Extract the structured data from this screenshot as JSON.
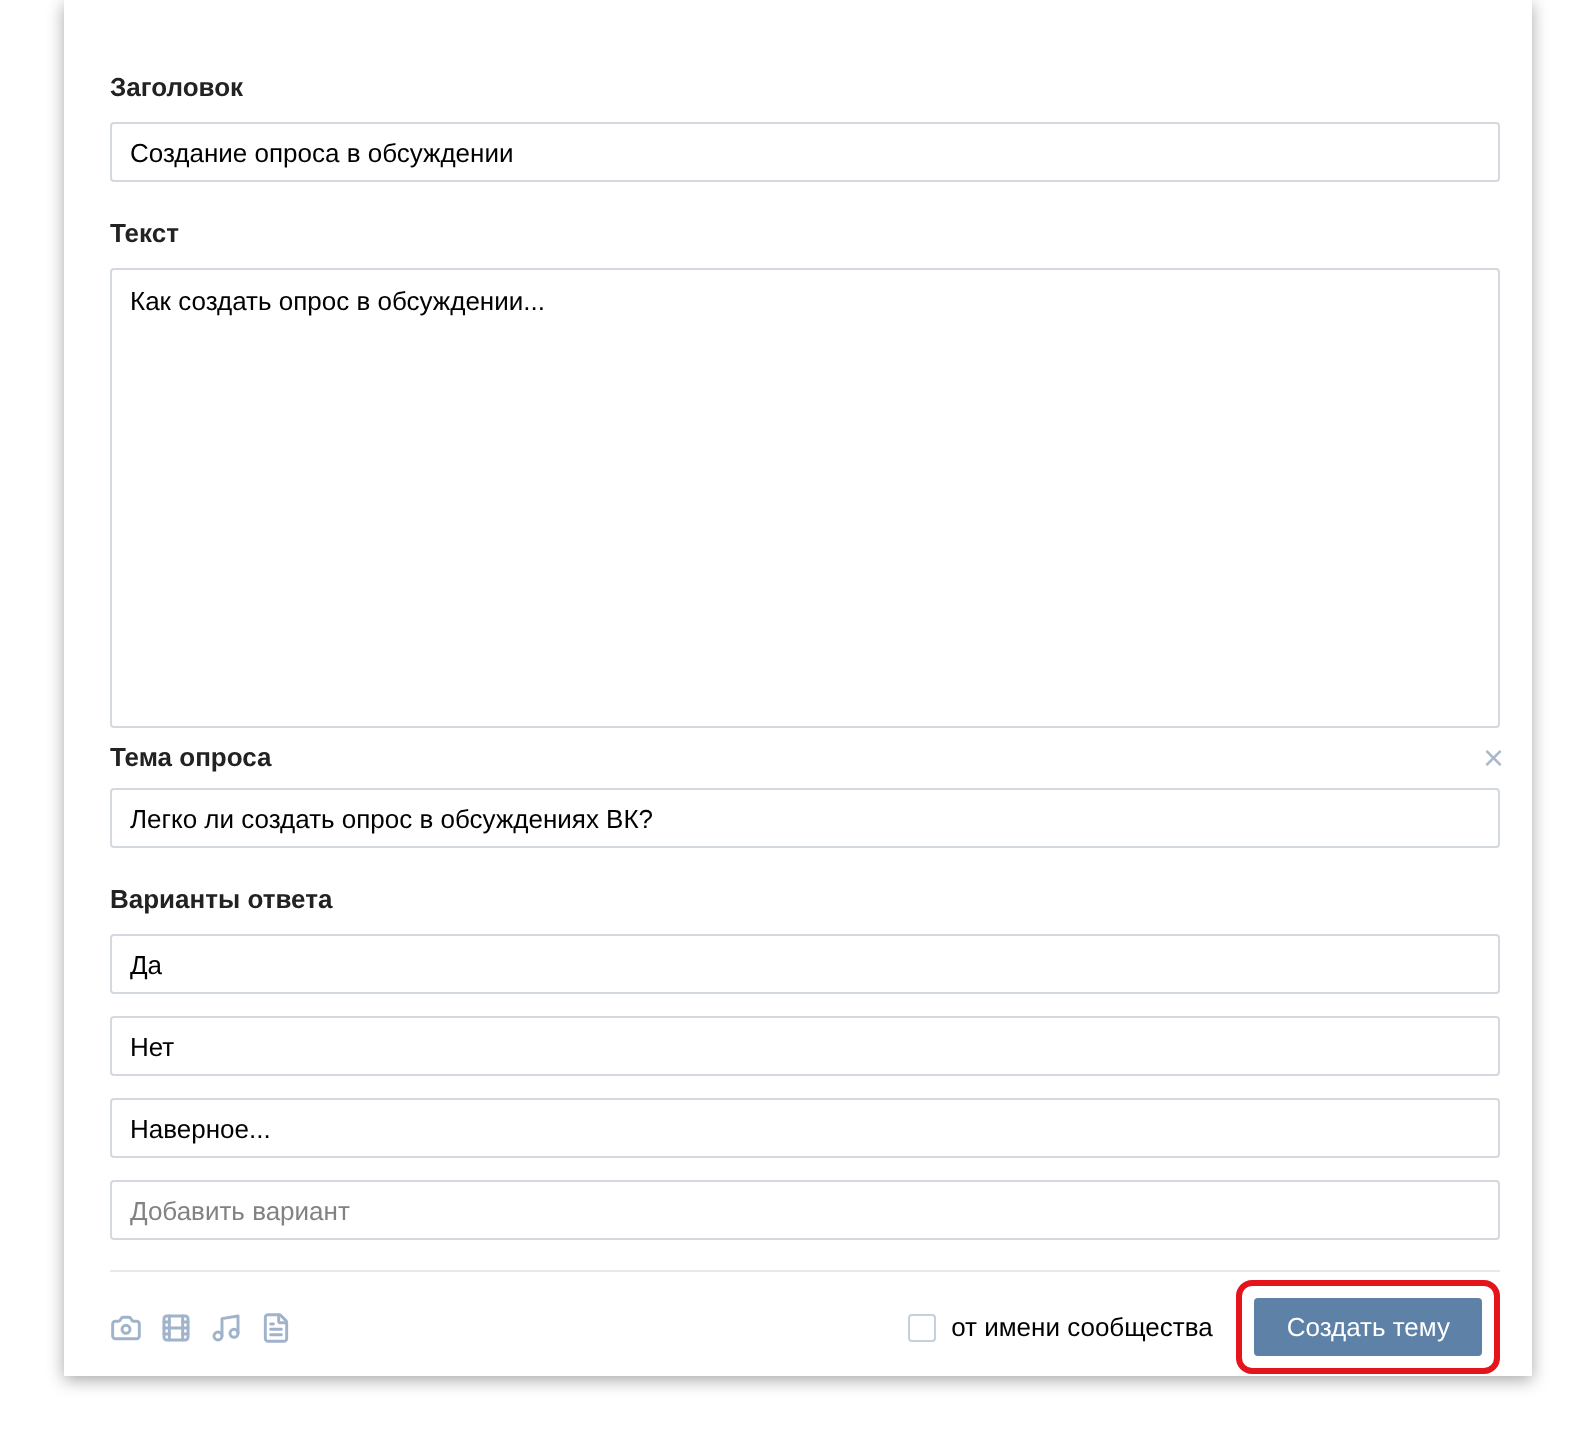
{
  "title_field": {
    "label": "Заголовок",
    "value": "Создание опроса в обсуждении"
  },
  "text_field": {
    "label": "Текст",
    "value": "Как создать опрос в обсуждении..."
  },
  "poll": {
    "label": "Тема опроса",
    "close": "×",
    "question": "Легко ли создать опрос в обсуждениях ВК?",
    "options_label": "Варианты ответа",
    "options": [
      {
        "value": "Да"
      },
      {
        "value": "Нет"
      },
      {
        "value": "Наверное..."
      },
      {
        "placeholder": "Добавить вариант"
      }
    ]
  },
  "footer": {
    "community": {
      "label": "от имени сообщества",
      "checked": false
    },
    "submit": {
      "label": "Создать тему",
      "highlighted": true
    }
  }
}
